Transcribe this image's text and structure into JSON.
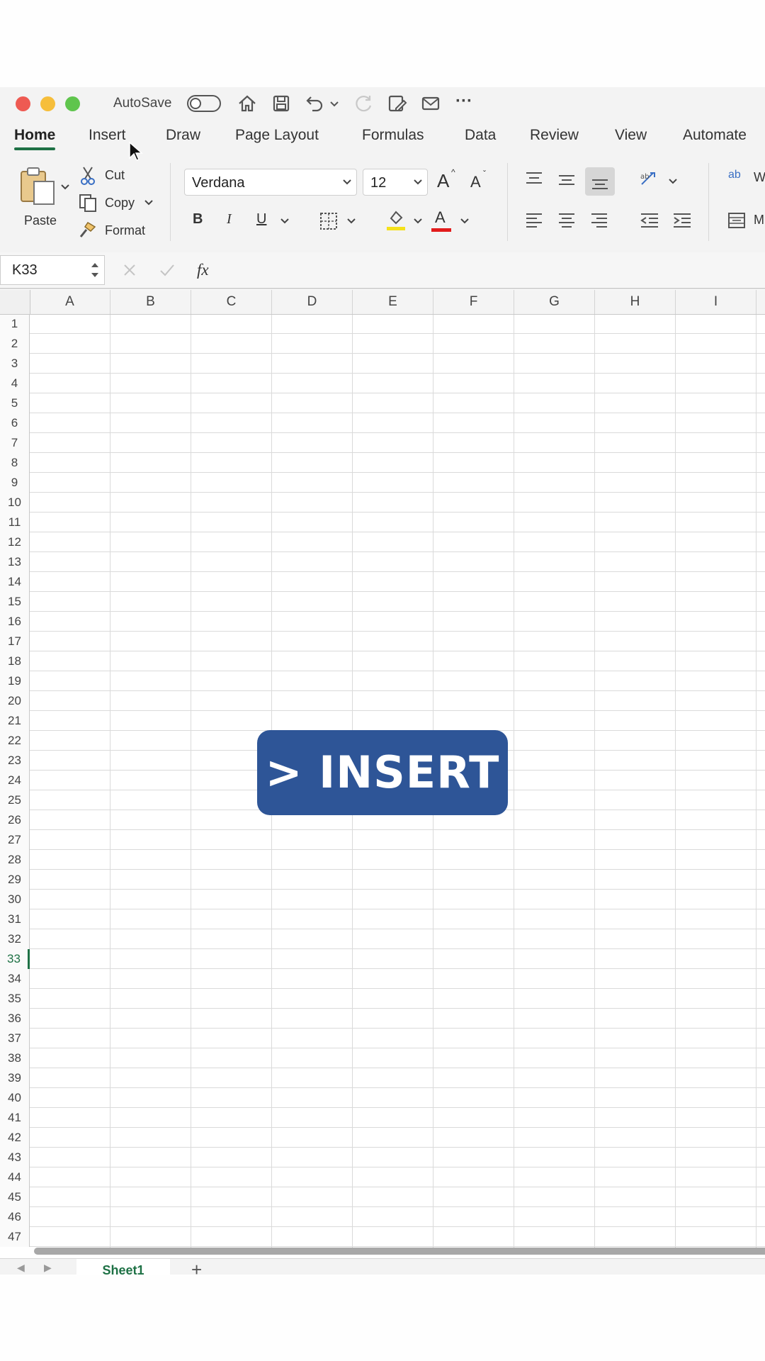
{
  "titlebar": {
    "autosave_label": "AutoSave",
    "more_label": "···"
  },
  "menu": {
    "tabs": [
      "Home",
      "Insert",
      "Draw",
      "Page Layout",
      "Formulas",
      "Data",
      "Review",
      "View",
      "Automate"
    ],
    "active": "Home"
  },
  "ribbon": {
    "paste_label": "Paste",
    "cut_label": "Cut",
    "copy_label": "Copy",
    "format_label": "Format",
    "font_name": "Verdana",
    "font_size": "12",
    "bold_label": "B",
    "italic_label": "I",
    "underline_label": "U",
    "font_color_letter": "A",
    "grow_font_label": "A",
    "shrink_font_label": "A",
    "wrap_partial": "W",
    "merge_partial": "M",
    "wrap_icon_text": "ab",
    "fill_color": "#f5e11b",
    "font_color": "#e21b1b"
  },
  "formula_bar": {
    "cell_ref": "K33",
    "fx_label": "fx",
    "value": ""
  },
  "grid": {
    "columns": [
      "A",
      "B",
      "C",
      "D",
      "E",
      "F",
      "G",
      "H",
      "I"
    ],
    "rows": [
      "1",
      "2",
      "3",
      "4",
      "5",
      "6",
      "7",
      "8",
      "9",
      "10",
      "11",
      "12",
      "13",
      "14",
      "15",
      "16",
      "17",
      "18",
      "19",
      "20",
      "21",
      "22",
      "23",
      "24",
      "25",
      "26",
      "27",
      "28",
      "29",
      "30",
      "31",
      "32",
      "33",
      "34",
      "35",
      "36",
      "37",
      "38",
      "39",
      "40",
      "41",
      "42",
      "43",
      "44",
      "45",
      "46",
      "47"
    ],
    "selected_row": "33"
  },
  "sheets": {
    "tabs": [
      "Sheet1"
    ],
    "add_label": "+"
  },
  "overlay": {
    "text": "> INSERT",
    "color": "#2e5597"
  },
  "colors": {
    "accent": "#1e7145"
  }
}
